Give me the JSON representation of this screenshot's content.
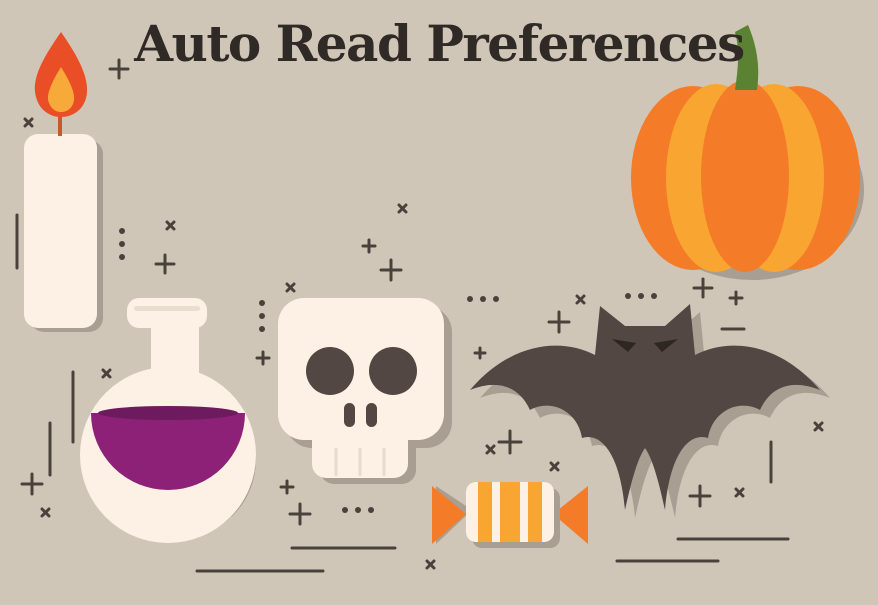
{
  "title": "Auto Read Preferences",
  "colors": {
    "background": "#d0c6b8",
    "ink": "#302a27",
    "pumpkin": "#f47b28",
    "pumpkin_light": "#f8a631",
    "stem": "#5a8232",
    "potion": "#8c2177",
    "candle": "#fcf1e4",
    "bat": "#524742"
  },
  "icons": [
    "candle-icon",
    "potion-flask-icon",
    "skull-icon",
    "bat-icon",
    "pumpkin-icon",
    "candy-icon"
  ]
}
